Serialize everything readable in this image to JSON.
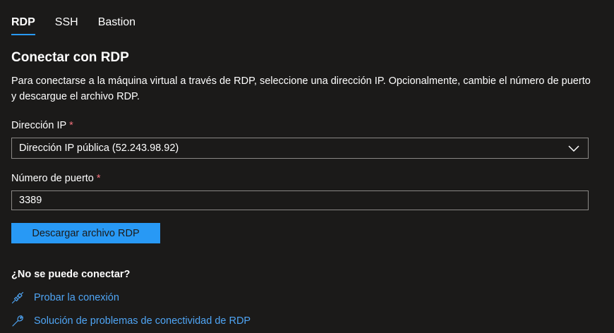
{
  "tabs": [
    {
      "label": "RDP",
      "active": true
    },
    {
      "label": "SSH",
      "active": false
    },
    {
      "label": "Bastion",
      "active": false
    }
  ],
  "section": {
    "title": "Conectar con RDP",
    "description": "Para conectarse a la máquina virtual a través de RDP, seleccione una dirección IP. Opcionalmente, cambie el número de puerto y descargue el archivo RDP."
  },
  "ip_field": {
    "label": "Dirección IP",
    "required_mark": "*",
    "selected": "Dirección IP pública (52.243.98.92)"
  },
  "port_field": {
    "label": "Número de puerto",
    "required_mark": "*",
    "value": "3389"
  },
  "download_button": {
    "label": "Descargar archivo RDP"
  },
  "help": {
    "title": "¿No se puede conectar?",
    "links": [
      {
        "label": "Probar la conexión",
        "icon": "plug-icon"
      },
      {
        "label": "Solución de problemas de conectividad de RDP",
        "icon": "wrench-icon"
      }
    ]
  },
  "colors": {
    "background": "#1b1a19",
    "accent": "#2899f5",
    "link": "#4fa5f5",
    "required": "#f1707b",
    "border": "#8a8886"
  }
}
